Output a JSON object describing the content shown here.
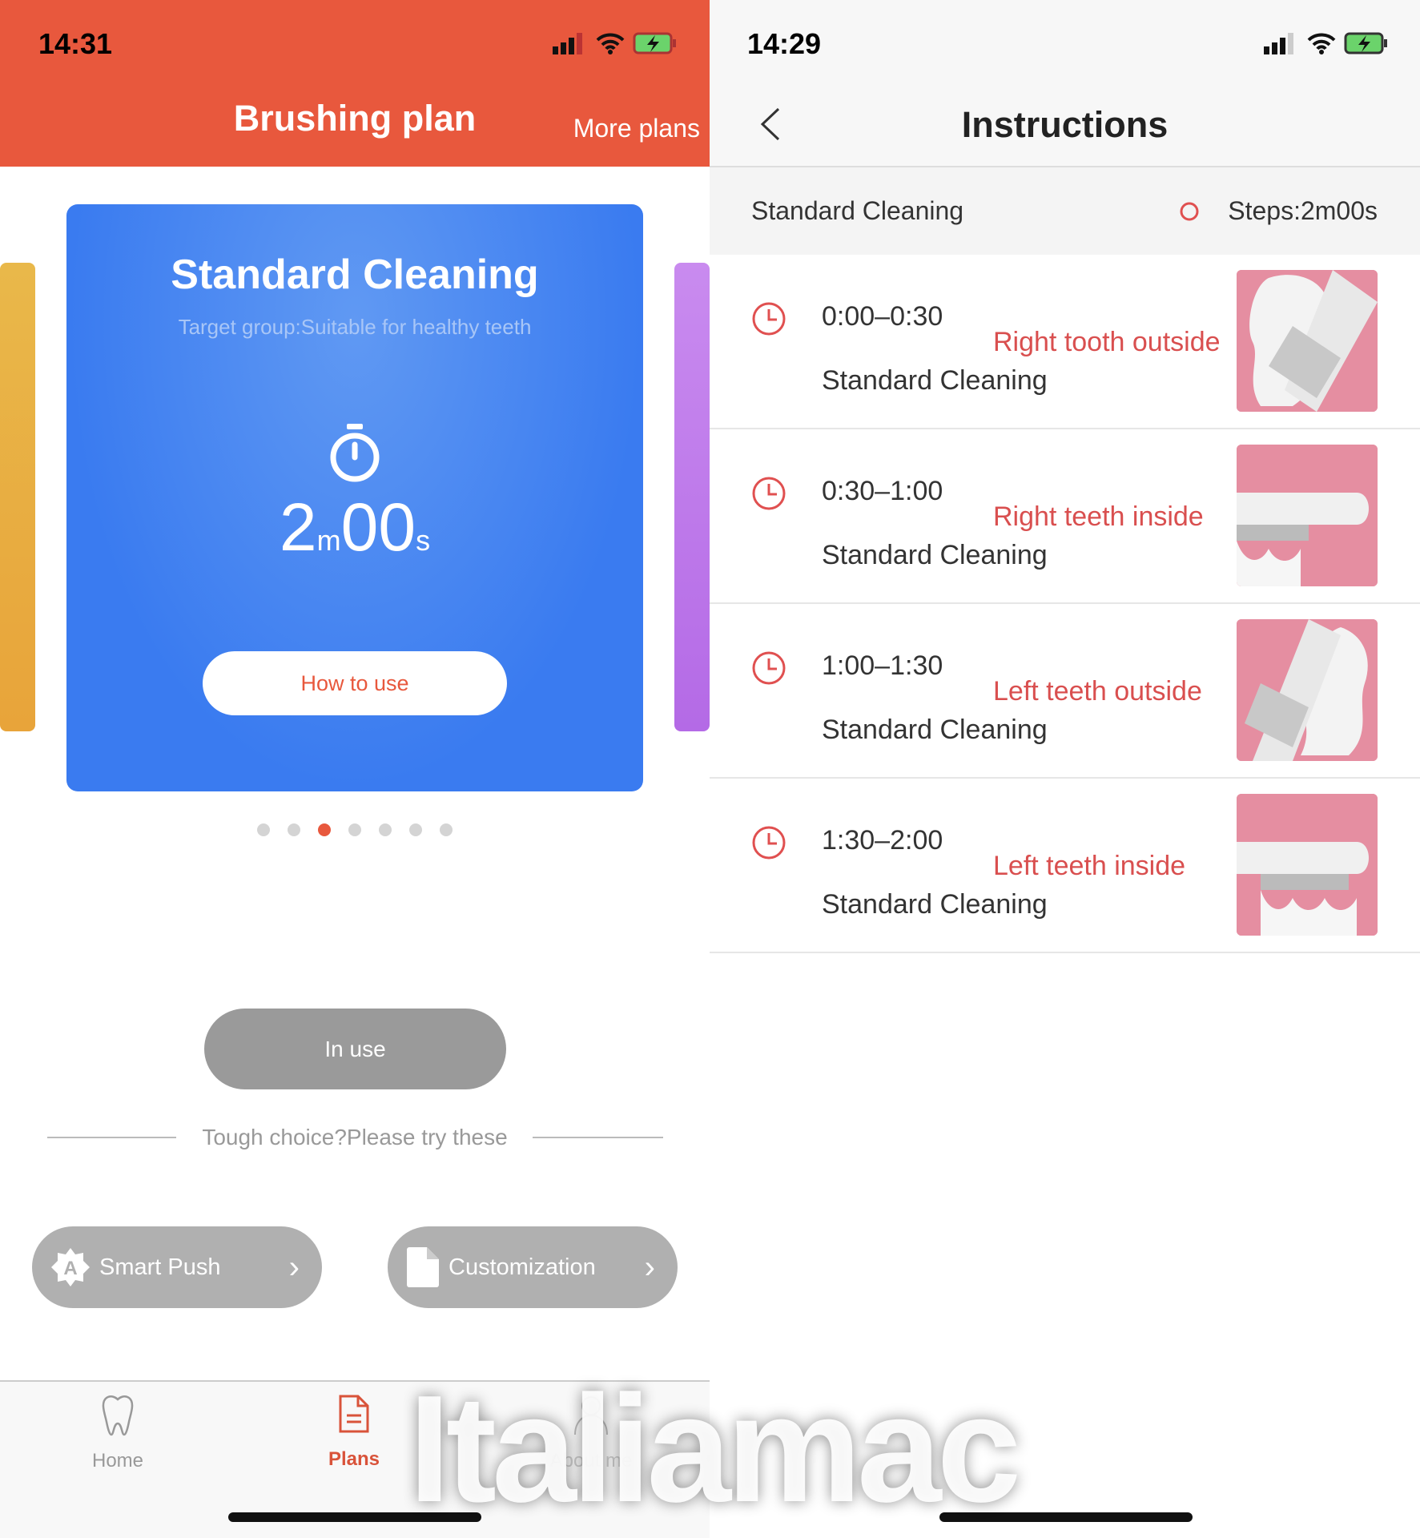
{
  "left": {
    "status": {
      "time": "14:31"
    },
    "header": {
      "title": "Brushing plan",
      "more_plans": "More plans"
    },
    "card": {
      "title": "Standard Cleaning",
      "target": "Target group:Suitable for healthy teeth",
      "minutes": "2",
      "minutes_unit": "m",
      "seconds": "00",
      "seconds_unit": "s",
      "how_to_use": "How to use",
      "color": "#3a7bf0"
    },
    "carousel": {
      "count": 7,
      "active_index": 2
    },
    "in_use": "In use",
    "divider_text": "Tough choice?Please try these",
    "smart_push": "Smart Push",
    "customization": "Customization",
    "tabs": [
      {
        "label": "Home",
        "icon": "tooth-icon"
      },
      {
        "label": "Plans",
        "icon": "document-icon",
        "active": true
      },
      {
        "label": "About me",
        "icon": "person-icon"
      }
    ],
    "accent": "#e8583d"
  },
  "right": {
    "status": {
      "time": "14:29"
    },
    "nav": {
      "title": "Instructions"
    },
    "summary": {
      "plan": "Standard Cleaning",
      "steps": "Steps:2m00s"
    },
    "steps": [
      {
        "time": "0:00–0:30",
        "area": "Right tooth outside",
        "plan": "Standard Cleaning"
      },
      {
        "time": "0:30–1:00",
        "area": "Right teeth inside",
        "plan": "Standard Cleaning"
      },
      {
        "time": "1:00–1:30",
        "area": "Left teeth outside",
        "plan": "Standard Cleaning"
      },
      {
        "time": "1:30–2:00",
        "area": "Left teeth inside",
        "plan": "Standard Cleaning"
      }
    ]
  },
  "watermark": "Italiamac"
}
